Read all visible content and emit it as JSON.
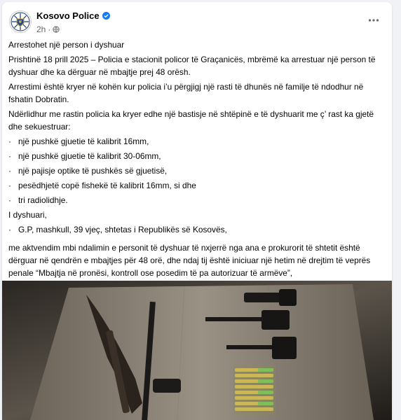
{
  "post": {
    "page_name": "Kosovo Police",
    "timestamp": "2h",
    "paragraphs": {
      "p0": "Arrestohet një person i dyshuar",
      "p1": "Prishtinë 18 prill 2025 – Policia e stacionit policor të Graçanicës, mbrëmë ka arrestuar një person të dyshuar dhe ka dërguar në mbajtje prej 48 orësh.",
      "p2": "Arrestimi është kryer në kohën kur policia i’u përgjigj një rasti të dhunës në familje të ndodhur në fshatin Dobratin.",
      "p3": "Ndërlidhur me rastin policia ka kryer edhe një bastisje në shtëpinë e të dyshuarit me ç’ rast ka gjetë dhe sekuestruar:",
      "b1": "një pushkë gjuetie të kalibrit 16mm,",
      "b2": "një pushkë gjuetie të kalibrit 30-06mm,",
      "b3": "një pajisje optike të pushkës së gjuetisë,",
      "b4": "pesëdhjetë copë fishekë të kalibrit 16mm, si dhe",
      "b5": "tri radiolidhje.",
      "p4": "I dyshuari,",
      "b6": "G.P, mashkull, 39 vjeç, shtetas i Republikës së Kosovës,",
      "p5": "me aktvendim mbi ndalimin e personit të dyshuar të nxjerrë nga ana e prokurorit të shtetit është dërguar në qendrën e mbajtjes për 48 orë, dhe ndaj tij është iniciuar një hetim në drejtim të veprës penale “Mbajtja në pronësi, kontroll ose posedim të pa autorizuar të armëve”,"
    },
    "bullet_char": "·"
  },
  "icons": {
    "verified": "verified-badge-icon",
    "audience": "globe-icon",
    "more": "more-options-icon"
  },
  "colors": {
    "verified_blue": "#1877f2",
    "secondary_text": "#65676b",
    "background": "#f0f2f5"
  }
}
